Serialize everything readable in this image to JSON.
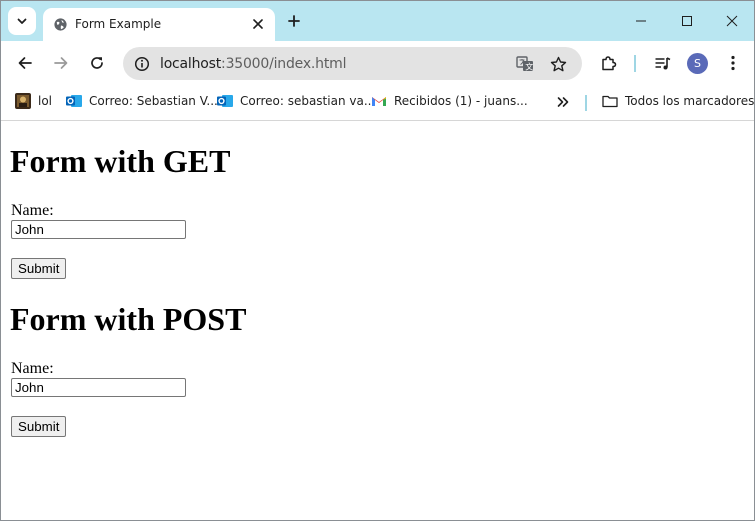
{
  "browser": {
    "tab": {
      "title": "Form Example"
    },
    "address_bar": {
      "host": "localhost",
      "rest": ":35000/index.html"
    },
    "profile_initial": "S",
    "bookmarks": [
      {
        "label": "lol",
        "icon": "image-thumbnail-icon"
      },
      {
        "label": "Correo: Sebastian V...",
        "icon": "outlook-icon"
      },
      {
        "label": "Correo: sebastian va...",
        "icon": "outlook-icon"
      },
      {
        "label": "Recibidos (1) - juans...",
        "icon": "gmail-icon"
      }
    ],
    "all_bookmarks_label": "Todos los marcadores",
    "accent_color": "#b9e6f1"
  },
  "page": {
    "get_form": {
      "heading": "Form with GET",
      "name_label": "Name:",
      "name_value": "John",
      "submit_label": "Submit"
    },
    "post_form": {
      "heading": "Form with POST",
      "name_label": "Name:",
      "name_value": "John",
      "submit_label": "Submit"
    }
  }
}
